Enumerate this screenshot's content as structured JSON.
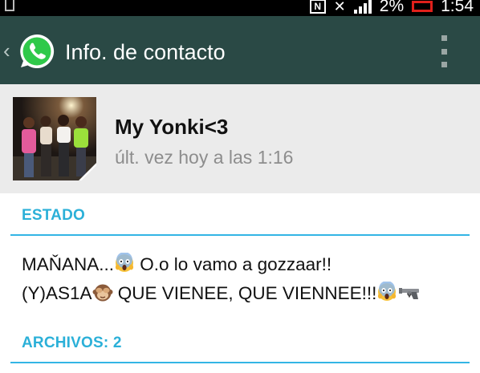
{
  "status_bar": {
    "battery_percent": "2%",
    "time": "1:54",
    "nfc_label": "N",
    "battery_color": "#e0201b"
  },
  "app_bar": {
    "title": "Info. de contacto",
    "background": "#2a4945"
  },
  "contact": {
    "name": "My Yonki<3",
    "last_seen": "últ. vez hoy a las 1:16"
  },
  "estado": {
    "title": "ESTADO",
    "line1_a": "MAŇANA...",
    "line1_b": " O.o lo vamo a gozzaar!!",
    "line2_a": "(Y)AS1A",
    "line2_b": " QUE VIENEE, QUE VIENNEE!!!",
    "emojis": [
      "face-screaming-in-fear",
      "see-no-evil-monkey",
      "face-screaming-in-fear",
      "pistol"
    ]
  },
  "archivos": {
    "title": "ARCHIVOS: 2"
  },
  "accent_color": "#33b5e5"
}
